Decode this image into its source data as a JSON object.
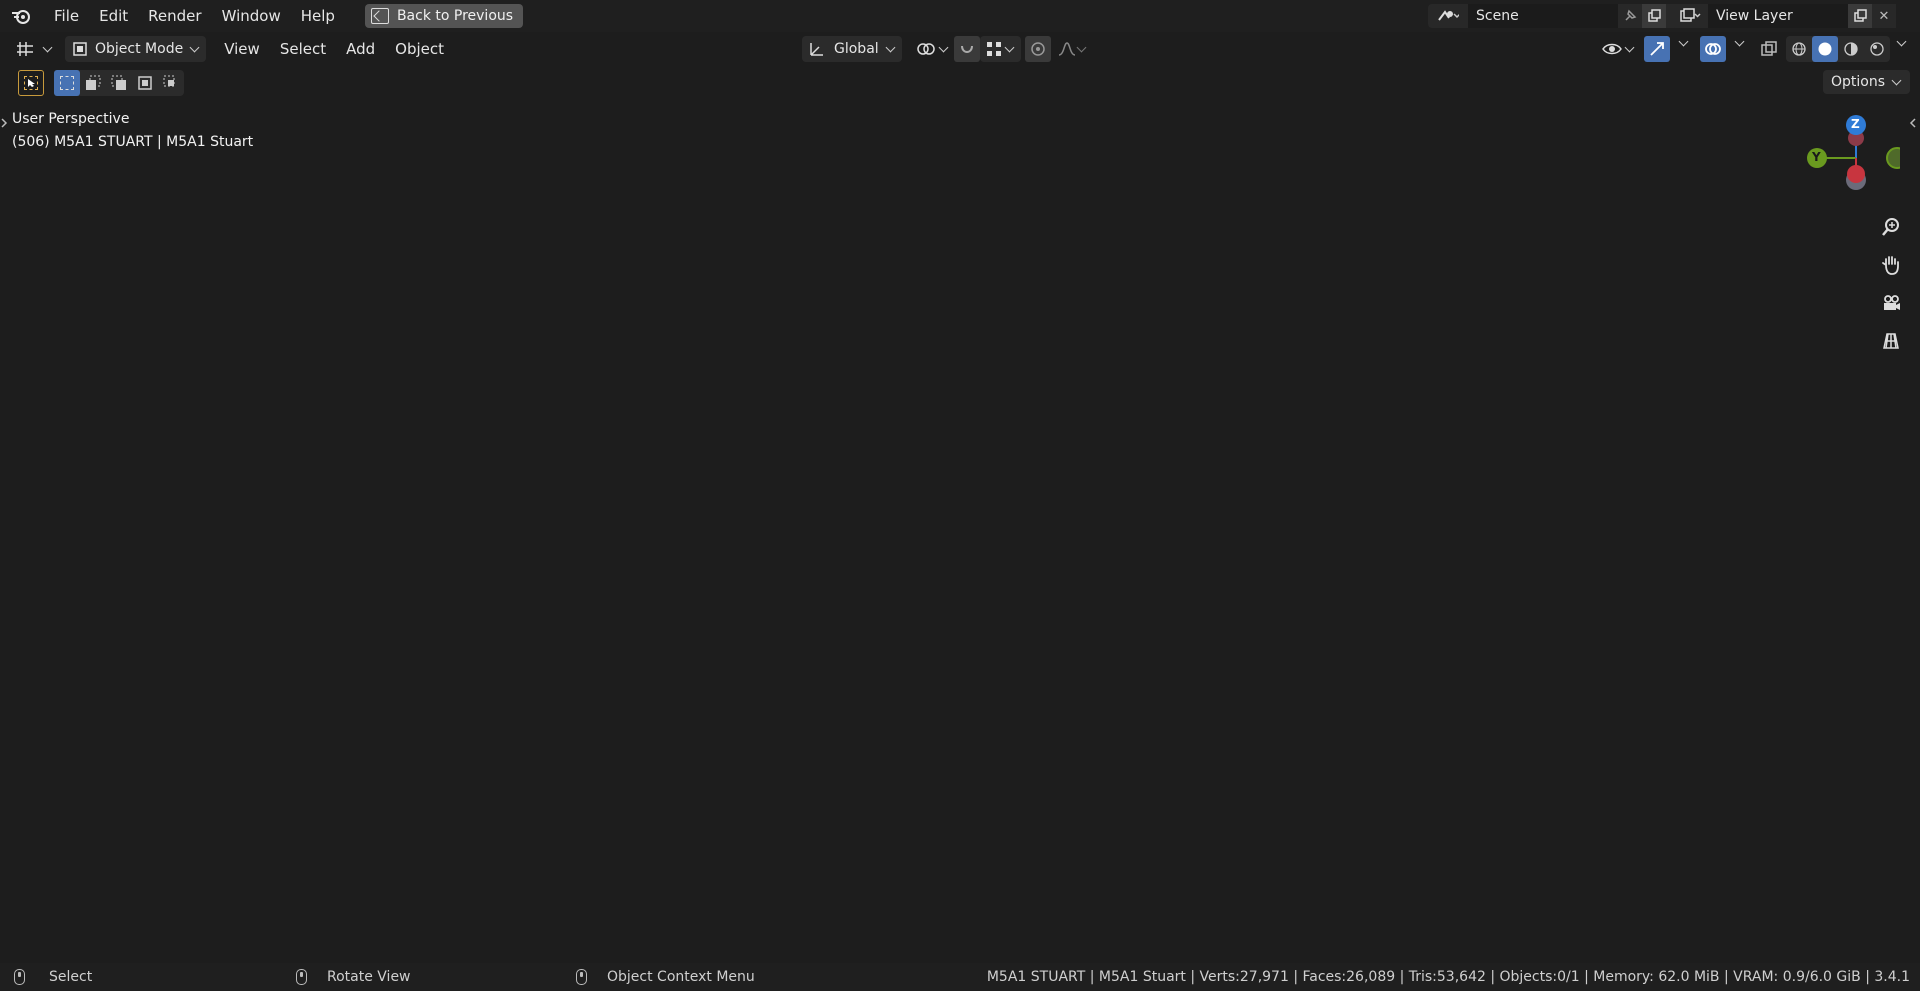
{
  "menubar": {
    "items": [
      "File",
      "Edit",
      "Render",
      "Window",
      "Help"
    ],
    "back_button": "Back to Previous"
  },
  "scene": {
    "name": "Scene"
  },
  "view_layer": {
    "name": "View Layer"
  },
  "header": {
    "mode": "Object Mode",
    "menus": [
      "View",
      "Select",
      "Add",
      "Object"
    ],
    "orientation": "Global"
  },
  "toolbar": {
    "options_label": "Options"
  },
  "viewport": {
    "perspective": "User Perspective",
    "object_info": "(506) M5A1 STUART | M5A1 Stuart"
  },
  "gizmo": {
    "z": "Z",
    "y": "Y"
  },
  "statusbar": {
    "select": "Select",
    "rotate": "Rotate View",
    "context": "Object Context Menu",
    "stats": "M5A1 STUART | M5A1 Stuart | Verts:27,971 | Faces:26,089 | Tris:53,642 | Objects:0/1 | Memory: 62.0 MiB | VRAM: 0.9/6.0 GiB | 3.4.1"
  },
  "colors": {
    "accent": "#4772b3",
    "x_axis": "#c8353f",
    "y_axis": "#6a9a1f",
    "z_axis": "#2f7bd6",
    "viewport_bg": "#3d3d3d"
  }
}
